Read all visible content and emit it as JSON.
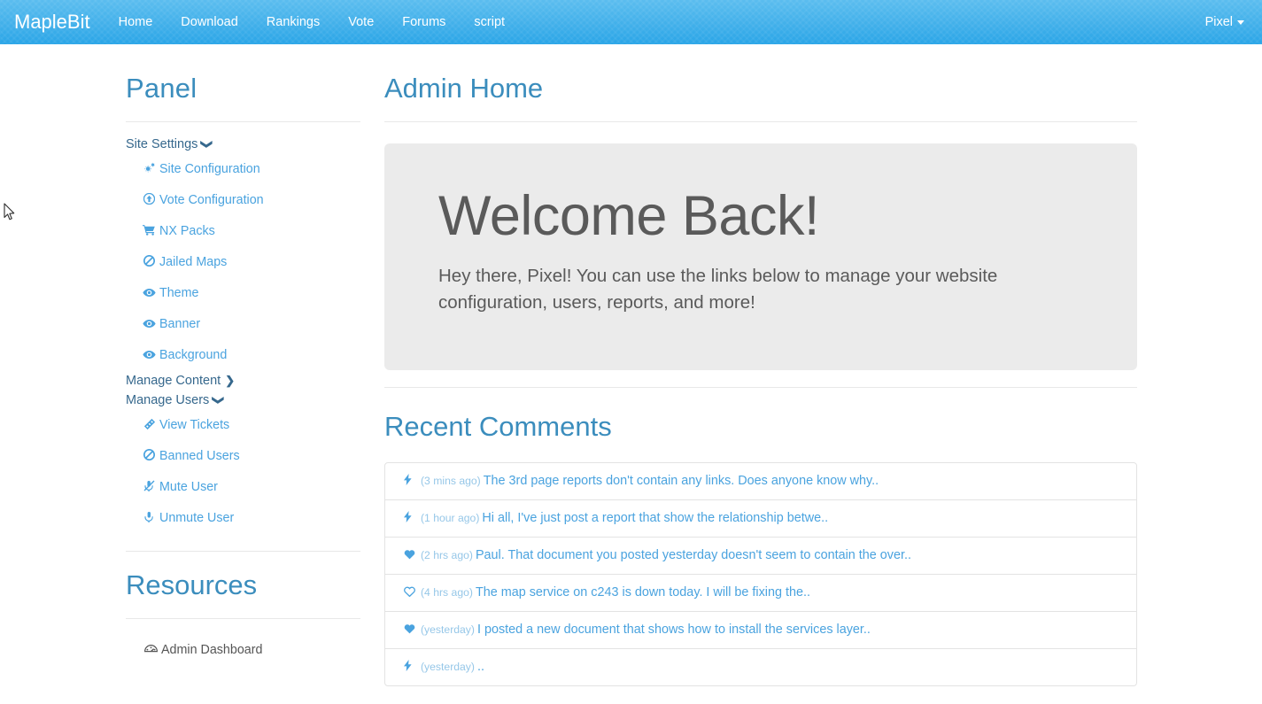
{
  "navbar": {
    "brand": "MapleBit",
    "links": [
      {
        "label": "Home"
      },
      {
        "label": "Download"
      },
      {
        "label": "Rankings"
      },
      {
        "label": "Vote"
      },
      {
        "label": "Forums"
      },
      {
        "label": "script"
      }
    ],
    "user": "Pixel",
    "brand_color": "#ffffff",
    "background_color": "#41b0ea"
  },
  "sidebar": {
    "panel_title": "Panel",
    "groups": [
      {
        "label": "Site Settings",
        "chevron": "chevron-down",
        "expanded": true,
        "items": [
          {
            "label": "Site Configuration",
            "icon": "cogs-icon",
            "glyph": "⚙"
          },
          {
            "label": "Vote Configuration",
            "icon": "arrow-circle-up-icon",
            "glyph": "⬆"
          },
          {
            "label": "NX Packs",
            "icon": "shopping-cart-icon",
            "glyph": "🛒"
          },
          {
            "label": "Jailed Maps",
            "icon": "ban-icon",
            "glyph": "⊘"
          },
          {
            "label": "Theme",
            "icon": "eye-icon",
            "glyph": "👁"
          },
          {
            "label": "Banner",
            "icon": "eye-icon",
            "glyph": "👁"
          },
          {
            "label": "Background",
            "icon": "eye-icon",
            "glyph": "👁"
          }
        ]
      },
      {
        "label": "Manage Content",
        "chevron": "chevron-right",
        "expanded": false,
        "items": []
      },
      {
        "label": "Manage Users",
        "chevron": "chevron-down",
        "expanded": true,
        "items": [
          {
            "label": "View Tickets",
            "icon": "ticket-icon",
            "glyph": "🎫"
          },
          {
            "label": "Banned Users",
            "icon": "ban-icon",
            "glyph": "⊘"
          },
          {
            "label": "Mute User",
            "icon": "microphone-slash-icon",
            "glyph": "🎙"
          },
          {
            "label": "Unmute User",
            "icon": "microphone-icon",
            "glyph": "🎙"
          }
        ]
      }
    ],
    "resources_title": "Resources",
    "resources": [
      {
        "label": "Admin Dashboard",
        "icon": "dashboard-icon",
        "glyph": "⚙"
      }
    ]
  },
  "main": {
    "page_title": "Admin Home",
    "jumbotron": {
      "heading": "Welcome Back!",
      "text": "Hey there, Pixel! You can use the links below to manage your website configuration, users, reports, and more!"
    },
    "recent_comments_title": "Recent Comments",
    "comments": [
      {
        "icon": "bolt-icon",
        "when": "(3 mins ago)",
        "text": "The 3rd page reports don't contain any links. Does anyone know why.."
      },
      {
        "icon": "bolt-icon",
        "when": "(1 hour ago)",
        "text": "Hi all, I've just post a report that show the relationship betwe.."
      },
      {
        "icon": "heart-filled-icon",
        "when": "(2 hrs ago)",
        "text": "Paul. That document you posted yesterday doesn't seem to contain the over.."
      },
      {
        "icon": "heart-outline-icon",
        "when": "(4 hrs ago)",
        "text": "The map service on c243 is down today. I will be fixing the.."
      },
      {
        "icon": "heart-filled-icon",
        "when": "(yesterday)",
        "text": "I posted a new document that shows how to install the services layer.."
      },
      {
        "icon": "bolt-icon",
        "when": "(yesterday)",
        "text": ".."
      }
    ]
  },
  "theme": {
    "link_blue": "#4aa3df",
    "heading_blue": "#3b8dbd",
    "jumbotron_bg": "#ebebeb",
    "text_gray": "#5a5a5a"
  }
}
